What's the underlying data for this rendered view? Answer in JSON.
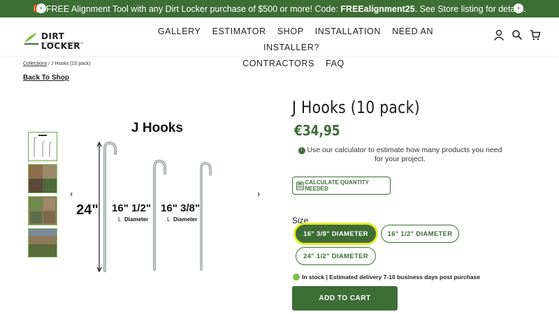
{
  "announcement": {
    "emoji": "🎁",
    "prefix": "FREE Alignment Tool with any Dirt Locker purchase of $500 or more! Code:",
    "code": "FREEalignment25",
    "suffix": ". See Store listing for details."
  },
  "logo": {
    "brand": "DIRT LOCKER",
    "tagline": "KEEP WITH YOUR SLOPE"
  },
  "nav": [
    "GALLERY",
    "ESTIMATOR",
    "SHOP",
    "INSTALLATION",
    "NEED AN INSTALLER?",
    "CONTRACTORS",
    "FAQ"
  ],
  "breadcrumb": {
    "link": "Collections",
    "separator": " / ",
    "current": "J Hooks (10 pack)"
  },
  "back_link": "Back To Shop",
  "gallery": {
    "title": "J Hooks",
    "label_24": "24\"",
    "label_a": "16\" 1/2\"",
    "label_b": "16\" 3/8\"",
    "diameter": "Diameter"
  },
  "product": {
    "title": "J Hooks (10 pack)",
    "price": "€34,95",
    "calc_note": "Use our calculator to estimate how many products you need for your project.",
    "calc_button": "CALCULATE QUANTITY NEEDED",
    "size_label": "Size",
    "sizes": [
      "16\" 3/8\" DIAMETER",
      "16\" 1/2\" DIAMETER",
      "24\" 1/2\" DIAMETER"
    ],
    "selected_size": "16\" 3/8\" DIAMETER",
    "stock": "In stock | Estimated delivery 7-10 business days post purchase",
    "add_to_cart": "ADD TO CART"
  },
  "colors": {
    "brand_green": "#3d6e35",
    "highlight": "#e8ea2a",
    "stock_dot": "#7bc142"
  }
}
